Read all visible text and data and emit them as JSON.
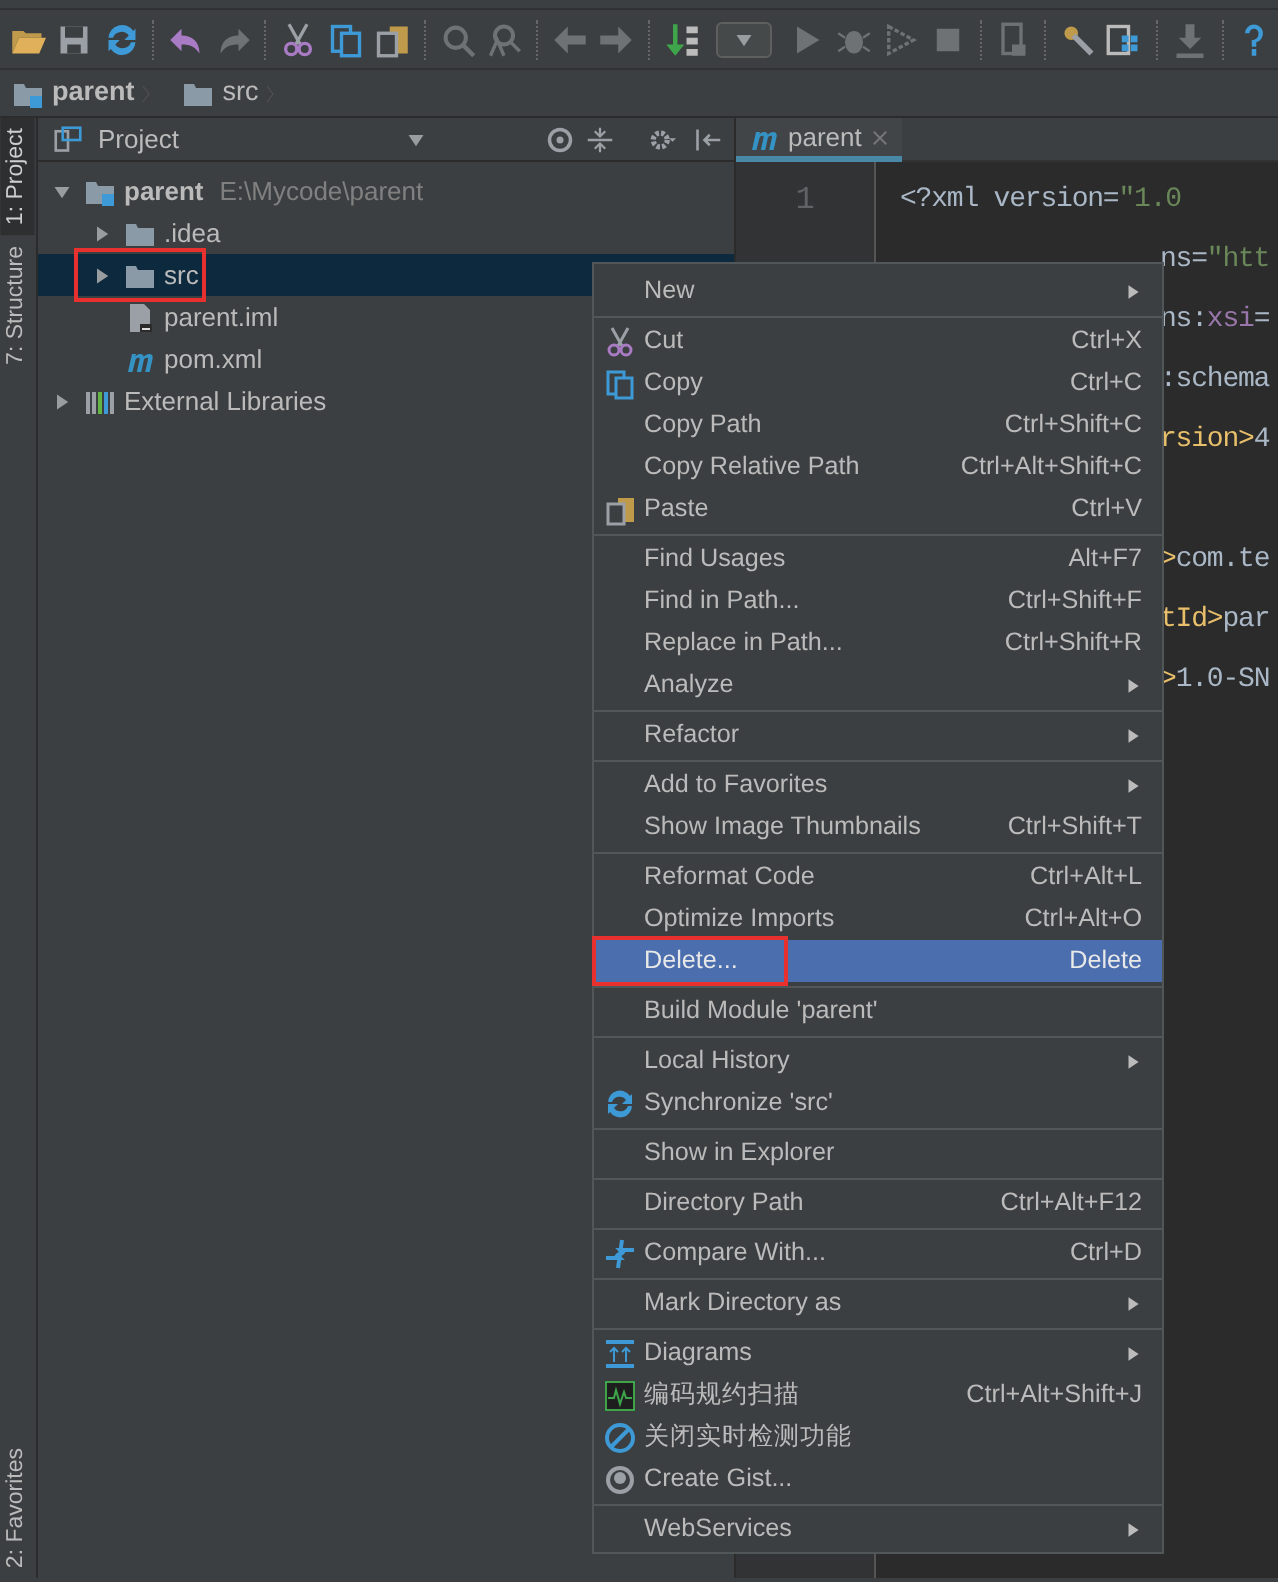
{
  "breadcrumbs": [
    {
      "label": "parent",
      "kind": "module"
    },
    {
      "label": "src",
      "kind": "folder"
    }
  ],
  "tool_windows": {
    "top": [
      {
        "label": "1: Project",
        "selected": true
      },
      {
        "label": "7: Structure",
        "selected": false
      }
    ],
    "bottom": [
      {
        "label": "2: Favorites",
        "selected": false
      }
    ]
  },
  "project_panel": {
    "title": "Project",
    "tree": [
      {
        "label": "parent",
        "path": "E:\\Mycode\\parent",
        "kind": "module",
        "expanded": true,
        "selected": false,
        "children": [
          {
            "label": ".idea",
            "kind": "folder",
            "expanded": false,
            "selected": false
          },
          {
            "label": "src",
            "kind": "folder",
            "expanded": false,
            "selected": true,
            "annotated": true
          },
          {
            "label": "parent.iml",
            "kind": "iml",
            "selected": false
          },
          {
            "label": "pom.xml",
            "kind": "maven",
            "selected": false
          }
        ]
      },
      {
        "label": "External Libraries",
        "kind": "library",
        "expanded": false,
        "selected": false
      }
    ]
  },
  "editor": {
    "tabs": [
      {
        "label": "parent",
        "selected": true
      }
    ],
    "lines": [
      {
        "number": "1",
        "kind": "full",
        "segments": [
          {
            "text": "<?xml version=",
            "kind": "plain"
          },
          {
            "text": "\"1.0",
            "kind": "value"
          }
        ]
      },
      {
        "kind": "partial",
        "segments": [
          {
            "text": "ns=",
            "kind": "plain"
          },
          {
            "text": "\"htt",
            "kind": "value"
          }
        ]
      },
      {
        "kind": "partial",
        "segments": [
          {
            "text": "ns:",
            "kind": "plain"
          },
          {
            "text": "xsi",
            "kind": "namespace"
          },
          {
            "text": "=",
            "kind": "plain"
          }
        ]
      },
      {
        "kind": "partial",
        "segments": [
          {
            "text": ":schema",
            "kind": "plain"
          }
        ]
      },
      {
        "kind": "partial",
        "segments": [
          {
            "text": "rsion>",
            "kind": "tag"
          },
          {
            "text": "4",
            "kind": "plain"
          }
        ]
      },
      {
        "kind": "partial"
      },
      {
        "kind": "partial",
        "segments": [
          {
            "text": ">",
            "kind": "tag"
          },
          {
            "text": "com.te",
            "kind": "plain"
          }
        ]
      },
      {
        "kind": "partial",
        "segments": [
          {
            "text": "tId>",
            "kind": "tag"
          },
          {
            "text": "par",
            "kind": "plain"
          }
        ]
      },
      {
        "kind": "partial",
        "segments": [
          {
            "text": ">",
            "kind": "tag"
          },
          {
            "text": "1.0-SN",
            "kind": "plain"
          }
        ]
      }
    ]
  },
  "context_menu": {
    "groups": [
      [
        {
          "label": "New",
          "submenu": true,
          "selected": false
        }
      ],
      [
        {
          "label": "Cut",
          "shortcut": "Ctrl+X",
          "selected": false
        },
        {
          "label": "Copy",
          "shortcut": "Ctrl+C",
          "selected": false
        },
        {
          "label": "Copy Path",
          "shortcut": "Ctrl+Shift+C",
          "selected": false
        },
        {
          "label": "Copy Relative Path",
          "shortcut": "Ctrl+Alt+Shift+C",
          "selected": false
        },
        {
          "label": "Paste",
          "shortcut": "Ctrl+V",
          "selected": false
        }
      ],
      [
        {
          "label": "Find Usages",
          "shortcut": "Alt+F7",
          "selected": false
        },
        {
          "label": "Find in Path...",
          "shortcut": "Ctrl+Shift+F",
          "selected": false
        },
        {
          "label": "Replace in Path...",
          "shortcut": "Ctrl+Shift+R",
          "selected": false
        },
        {
          "label": "Analyze",
          "submenu": true,
          "selected": false
        }
      ],
      [
        {
          "label": "Refactor",
          "submenu": true,
          "selected": false
        }
      ],
      [
        {
          "label": "Add to Favorites",
          "submenu": true,
          "selected": false
        },
        {
          "label": "Show Image Thumbnails",
          "shortcut": "Ctrl+Shift+T",
          "selected": false
        }
      ],
      [
        {
          "label": "Reformat Code",
          "shortcut": "Ctrl+Alt+L",
          "selected": false
        },
        {
          "label": "Optimize Imports",
          "shortcut": "Ctrl+Alt+O",
          "selected": false
        },
        {
          "label": "Delete...",
          "shortcut": "Delete",
          "selected": true,
          "annotated": true
        }
      ],
      [
        {
          "label": "Build Module 'parent'",
          "selected": false
        }
      ],
      [
        {
          "label": "Local History",
          "submenu": true,
          "selected": false
        },
        {
          "label": "Synchronize 'src'",
          "selected": false
        }
      ],
      [
        {
          "label": "Show in Explorer",
          "selected": false
        }
      ],
      [
        {
          "label": "Directory Path",
          "shortcut": "Ctrl+Alt+F12",
          "selected": false
        }
      ],
      [
        {
          "label": "Compare With...",
          "shortcut": "Ctrl+D",
          "selected": false
        }
      ],
      [
        {
          "label": "Mark Directory as",
          "submenu": true,
          "selected": false
        }
      ],
      [
        {
          "label": "Diagrams",
          "submenu": true,
          "selected": false
        },
        {
          "label": "编码规约扫描",
          "shortcut": "Ctrl+Alt+Shift+J",
          "selected": false
        },
        {
          "label": "关闭实时检测功能",
          "selected": false
        },
        {
          "label": "Create Gist...",
          "selected": false
        }
      ],
      [
        {
          "label": "WebServices",
          "submenu": true,
          "selected": false
        }
      ]
    ]
  }
}
